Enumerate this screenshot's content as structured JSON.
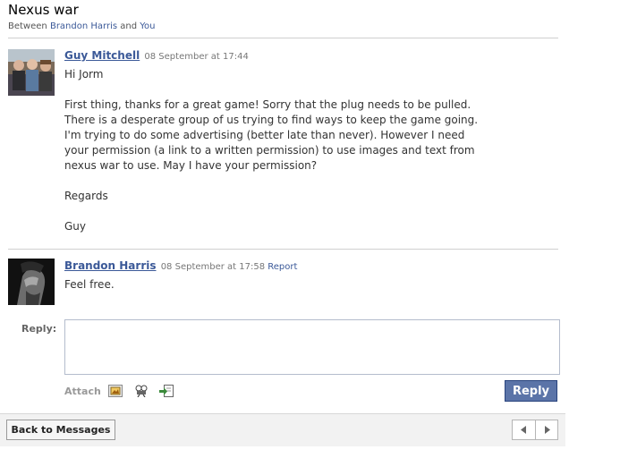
{
  "thread": {
    "title": "Nexus war",
    "between_prefix": "Between",
    "participant_1": "Brandon Harris",
    "and_text": "and",
    "participant_2": "You"
  },
  "messages": [
    {
      "author": "Guy Mitchell",
      "timestamp": "08 September at 17:44",
      "paragraphs": [
        "Hi Jorm",
        "First thing, thanks for a great game! Sorry that the plug needs to be pulled.",
        "There is a desperate group of us trying to find ways to keep the game going.",
        "I'm trying to do some advertising (better late than never). However I need",
        "your permission (a link to a written permission) to use images and text from",
        "nexus war to use. May I have your permission?",
        "Regards",
        "Guy"
      ]
    },
    {
      "author": "Brandon Harris",
      "timestamp": "08 September at 17:58",
      "report_label": "Report",
      "paragraphs": [
        "Feel free."
      ]
    }
  ],
  "reply": {
    "label": "Reply:",
    "attach_label": "Attach",
    "button_label": "Reply",
    "attach_icons": [
      "photo-icon",
      "video-icon",
      "link-icon"
    ]
  },
  "footer": {
    "back_label": "Back to Messages",
    "prev_icon": "triangle-left-icon",
    "next_icon": "triangle-right-icon"
  }
}
